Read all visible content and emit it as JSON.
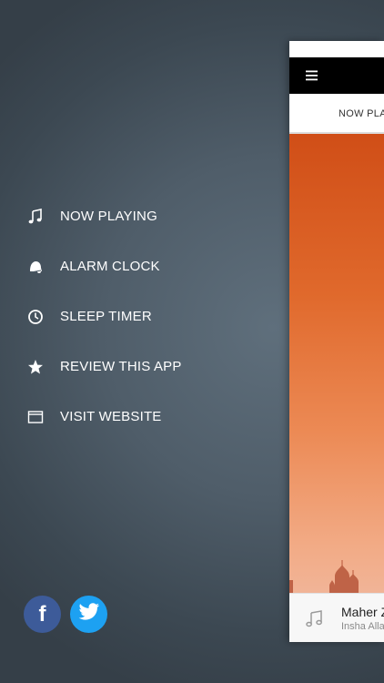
{
  "menu": {
    "items": [
      {
        "label": "NOW PLAYING",
        "icon": "music-note-icon"
      },
      {
        "label": "ALARM CLOCK",
        "icon": "alarm-bell-icon"
      },
      {
        "label": "SLEEP TIMER",
        "icon": "clock-icon"
      },
      {
        "label": "REVIEW THIS APP",
        "icon": "star-icon"
      },
      {
        "label": "VISIT WEBSITE",
        "icon": "browser-window-icon"
      }
    ]
  },
  "social": {
    "facebook_glyph": "f",
    "facebook_color": "#3d5b99",
    "twitter_color": "#1da1f2"
  },
  "app": {
    "tab_label": "NOW PLA",
    "player": {
      "title": "Maher Z",
      "subtitle": "Insha Alla"
    },
    "artwork_colors": [
      "#d04e17",
      "#f1b497"
    ]
  }
}
